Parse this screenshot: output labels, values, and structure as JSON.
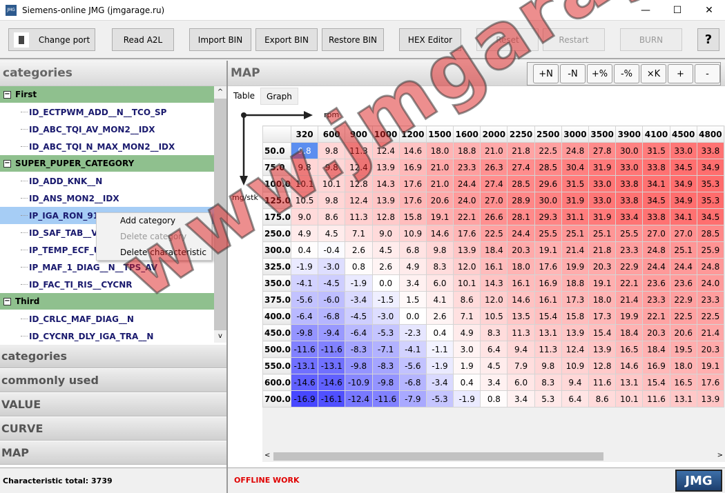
{
  "window": {
    "title": "Siemens-online JMG (jmgarage.ru)",
    "logo": "JMG",
    "minimize": "—",
    "maximize": "☐",
    "close": "✕"
  },
  "toolbar": {
    "change_port": "Change port",
    "read_a2l": "Read A2L",
    "import_bin": "Import BIN",
    "export_bin": "Export BIN",
    "restore_bin": "Restore BIN",
    "hex_editor": "HEX Editor",
    "reset": "Reset",
    "restart": "Restart",
    "burn": "BURN",
    "help": "?"
  },
  "left": {
    "header": "categories",
    "tree": [
      {
        "type": "cat",
        "label": "First"
      },
      {
        "type": "item",
        "label": "ID_ECTPWM_ADD__N__TCO_SP"
      },
      {
        "type": "item",
        "label": "ID_ABC_TQI_AV_MON2__IDX"
      },
      {
        "type": "item",
        "label": "ID_ABC_TQI_N_MAX_MON2__IDX"
      },
      {
        "type": "cat",
        "label": "SUPER_PUPER_CATEGORY"
      },
      {
        "type": "item",
        "label": "ID_ADD_KNK__N"
      },
      {
        "type": "item",
        "label": "ID_ANS_MON2__IDX"
      },
      {
        "type": "item",
        "label": "IP_IGA_RON_91_F",
        "selected": true
      },
      {
        "type": "item",
        "label": "ID_SAF_TAB__V_S"
      },
      {
        "type": "item",
        "label": "IP_TEMP_ECF_UP_"
      },
      {
        "type": "item",
        "label": "IP_MAF_1_DIAG__N__TPS_AV"
      },
      {
        "type": "item",
        "label": "ID_FAC_TI_RIS__CYCNR"
      },
      {
        "type": "cat",
        "label": "Third"
      },
      {
        "type": "item",
        "label": "ID_CRLC_MAF_DIAG__N"
      },
      {
        "type": "item",
        "label": "ID_CYCNR_DLY_IGA_TRA__N"
      }
    ],
    "context_menu": {
      "add_category": "Add category",
      "delete_category": "Delete category",
      "delete_characteristic": "Delete characteristic"
    },
    "accordion": [
      "categories",
      "commonly used",
      "VALUE",
      "CURVE",
      "MAP"
    ],
    "status": "Characteristic total: 3739"
  },
  "right": {
    "header": "MAP",
    "ops": [
      "+N",
      "-N",
      "+%",
      "-%",
      "×K",
      "+",
      "-"
    ],
    "tabs": [
      "Table",
      "Graph"
    ],
    "x_axis": "rpm",
    "y_axis": "mg/stk",
    "status": "OFFLINE WORK",
    "logo": "JMG"
  },
  "table": {
    "cols": [
      "320",
      "600",
      "900",
      "1000",
      "1200",
      "1500",
      "1600",
      "2000",
      "2250",
      "2500",
      "3000",
      "3500",
      "3900",
      "4100",
      "4500",
      "4800"
    ],
    "rows": [
      {
        "h": "50.0",
        "v": [
          "9.8",
          "9.8",
          "11.3",
          "12.4",
          "14.6",
          "18.0",
          "18.8",
          "21.0",
          "21.8",
          "22.5",
          "24.8",
          "27.8",
          "30.0",
          "31.5",
          "33.0",
          "33.8"
        ]
      },
      {
        "h": "75.0",
        "v": [
          "9.8",
          "9.8",
          "12.4",
          "13.9",
          "16.9",
          "21.0",
          "23.3",
          "26.3",
          "27.4",
          "28.5",
          "30.4",
          "31.9",
          "33.0",
          "33.8",
          "34.5",
          "34.9"
        ]
      },
      {
        "h": "100.0",
        "v": [
          "10.1",
          "10.1",
          "12.8",
          "14.3",
          "17.6",
          "21.0",
          "24.4",
          "27.4",
          "28.5",
          "29.6",
          "31.5",
          "33.0",
          "33.8",
          "34.1",
          "34.9",
          "35.3"
        ]
      },
      {
        "h": "125.0",
        "v": [
          "10.5",
          "9.8",
          "12.4",
          "13.9",
          "17.6",
          "20.6",
          "24.0",
          "27.0",
          "28.9",
          "30.0",
          "31.9",
          "33.0",
          "33.8",
          "34.5",
          "34.9",
          "35.3"
        ]
      },
      {
        "h": "175.0",
        "v": [
          "9.0",
          "8.6",
          "11.3",
          "12.8",
          "15.8",
          "19.1",
          "22.1",
          "26.6",
          "28.1",
          "29.3",
          "31.1",
          "31.9",
          "33.4",
          "33.8",
          "34.1",
          "34.5"
        ]
      },
      {
        "h": "250.0",
        "v": [
          "4.9",
          "4.5",
          "7.1",
          "9.0",
          "10.9",
          "14.6",
          "17.6",
          "22.5",
          "24.4",
          "25.5",
          "25.1",
          "25.1",
          "25.5",
          "27.0",
          "27.0",
          "28.5"
        ]
      },
      {
        "h": "300.0",
        "v": [
          "0.4",
          "-0.4",
          "2.6",
          "4.5",
          "6.8",
          "9.8",
          "13.9",
          "18.4",
          "20.3",
          "19.1",
          "21.4",
          "21.8",
          "23.3",
          "24.8",
          "25.1",
          "25.9"
        ]
      },
      {
        "h": "325.0",
        "v": [
          "-1.9",
          "-3.0",
          "0.8",
          "2.6",
          "4.9",
          "8.3",
          "12.0",
          "16.1",
          "18.0",
          "17.6",
          "19.9",
          "20.3",
          "22.9",
          "24.4",
          "24.4",
          "24.8"
        ]
      },
      {
        "h": "350.0",
        "v": [
          "-4.1",
          "-4.5",
          "-1.9",
          "0.0",
          "3.4",
          "6.0",
          "10.1",
          "14.3",
          "16.1",
          "16.9",
          "18.8",
          "19.1",
          "22.1",
          "23.6",
          "23.6",
          "24.0"
        ]
      },
      {
        "h": "375.0",
        "v": [
          "-5.6",
          "-6.0",
          "-3.4",
          "-1.5",
          "1.5",
          "4.1",
          "8.6",
          "12.0",
          "14.6",
          "16.1",
          "17.3",
          "18.0",
          "21.4",
          "23.3",
          "22.9",
          "23.3"
        ]
      },
      {
        "h": "400.0",
        "v": [
          "-6.4",
          "-6.8",
          "-4.5",
          "-3.0",
          "0.0",
          "2.6",
          "7.1",
          "10.5",
          "13.5",
          "15.4",
          "15.8",
          "17.3",
          "19.9",
          "22.1",
          "22.5",
          "22.5"
        ]
      },
      {
        "h": "450.0",
        "v": [
          "-9.8",
          "-9.4",
          "-6.4",
          "-5.3",
          "-2.3",
          "0.4",
          "4.9",
          "8.3",
          "11.3",
          "13.1",
          "13.9",
          "15.4",
          "18.4",
          "20.3",
          "20.6",
          "21.4"
        ]
      },
      {
        "h": "500.0",
        "v": [
          "-11.6",
          "-11.6",
          "-8.3",
          "-7.1",
          "-4.1",
          "-1.1",
          "3.0",
          "6.4",
          "9.4",
          "11.3",
          "12.4",
          "13.9",
          "16.5",
          "18.4",
          "19.5",
          "20.3"
        ]
      },
      {
        "h": "550.0",
        "v": [
          "-13.1",
          "-13.1",
          "-9.8",
          "-8.3",
          "-5.6",
          "-1.9",
          "1.9",
          "4.5",
          "7.9",
          "9.8",
          "10.9",
          "12.8",
          "14.6",
          "16.9",
          "18.0",
          "19.1"
        ]
      },
      {
        "h": "600.0",
        "v": [
          "-14.6",
          "-14.6",
          "-10.9",
          "-9.8",
          "-6.8",
          "-3.4",
          "0.4",
          "3.4",
          "6.0",
          "8.3",
          "9.4",
          "11.6",
          "13.1",
          "15.4",
          "16.5",
          "17.6"
        ]
      },
      {
        "h": "700.0",
        "v": [
          "-16.9",
          "-16.1",
          "-12.4",
          "-11.6",
          "-7.9",
          "-5.3",
          "-1.9",
          "0.8",
          "3.4",
          "5.3",
          "6.4",
          "8.6",
          "10.1",
          "11.6",
          "13.1",
          "13.9"
        ]
      }
    ]
  },
  "watermark": "www.jmgarage.ru",
  "colors": {
    "category": "#8fc08e",
    "selected": "#a6cdf5",
    "offline": "#e00000",
    "hot": "#ff6b6b",
    "cold": "#4a4af0"
  }
}
